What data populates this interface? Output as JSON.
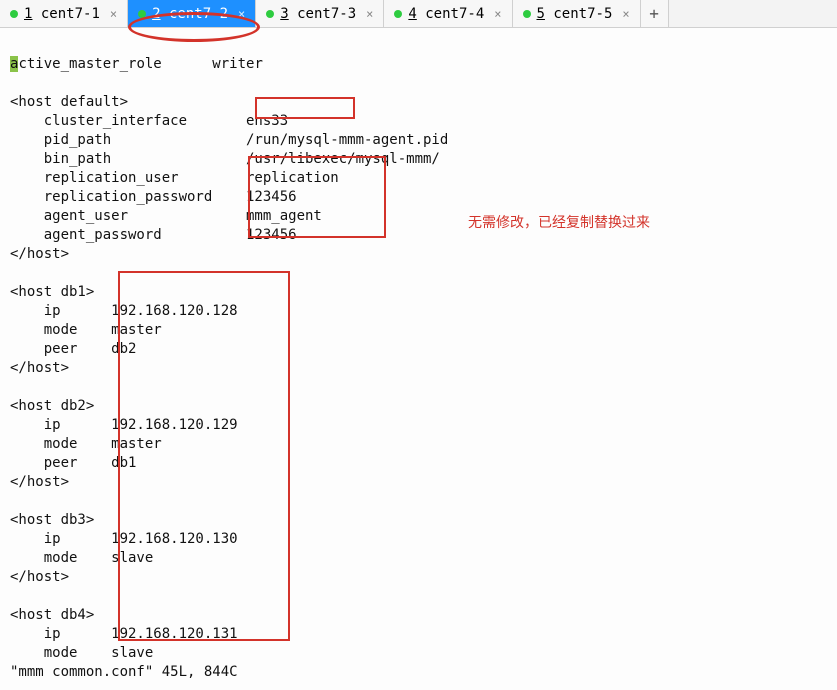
{
  "tabs": [
    {
      "num": "1",
      "label": "cent7-1",
      "active": false
    },
    {
      "num": "2",
      "label": "cent7-2",
      "active": true
    },
    {
      "num": "3",
      "label": "cent7-3",
      "active": false
    },
    {
      "num": "4",
      "label": "cent7-4",
      "active": false
    },
    {
      "num": "5",
      "label": "cent7-5",
      "active": false
    }
  ],
  "add_tab_glyph": "+",
  "close_glyph": "×",
  "cursor_char": "a",
  "line0_rest": "ctive_master_role      writer",
  "lines": {
    "l1": "",
    "l2": "<host default>",
    "l3": "    cluster_interface       ens33",
    "l4": "    pid_path                /run/mysql-mmm-agent.pid",
    "l5": "    bin_path                /usr/libexec/mysql-mmm/",
    "l6": "    replication_user        replication",
    "l7": "    replication_password    123456",
    "l8": "    agent_user              mmm_agent",
    "l9": "    agent_password          123456",
    "l10": "</host>",
    "l11": "",
    "l12": "<host db1>",
    "l13": "    ip      192.168.120.128",
    "l14": "    mode    master",
    "l15": "    peer    db2",
    "l16": "</host>",
    "l17": "",
    "l18": "<host db2>",
    "l19": "    ip      192.168.120.129",
    "l20": "    mode    master",
    "l21": "    peer    db1",
    "l22": "</host>",
    "l23": "",
    "l24": "<host db3>",
    "l25": "    ip      192.168.120.130",
    "l26": "    mode    slave",
    "l27": "</host>",
    "l28": "",
    "l29": "<host db4>",
    "l30": "    ip      192.168.120.131",
    "l31": "    mode    slave"
  },
  "status_line": "\"mmm common.conf\" 45L, 844C",
  "annotation_text": "无需修改，已经复制替换过来"
}
